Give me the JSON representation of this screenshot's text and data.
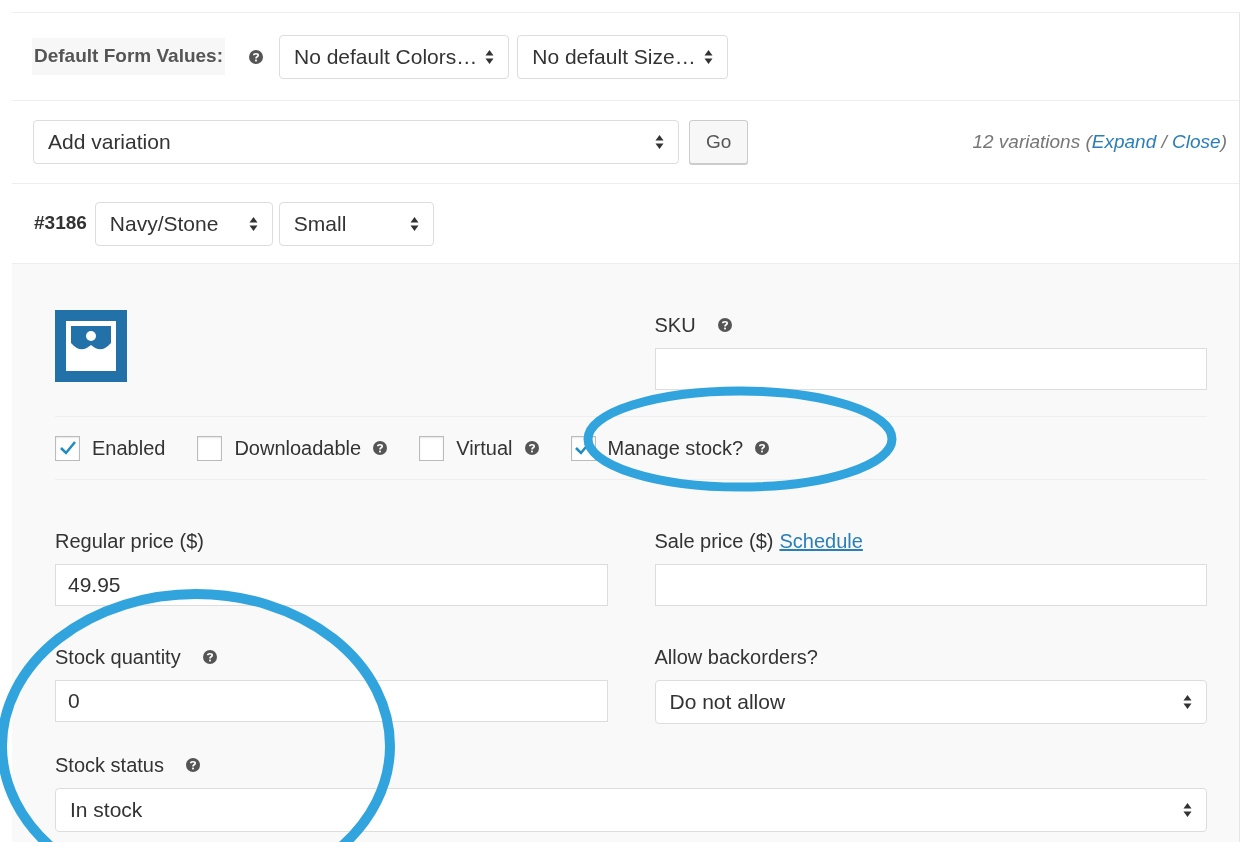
{
  "default_form_values": {
    "label": "Default Form Values:",
    "help": true,
    "selects": [
      {
        "value": "No default Colors…"
      },
      {
        "value": "No default Size…"
      }
    ]
  },
  "add_variation": {
    "select": "Add variation",
    "button": "Go",
    "summary": {
      "prefix": "12 variations (",
      "links": [
        {
          "label": "Expand"
        },
        {
          "label": "Close"
        }
      ],
      "separator": " / ",
      "suffix": ")"
    }
  },
  "variation": {
    "id": "#3186",
    "selects": [
      {
        "value": "Navy/Stone"
      },
      {
        "value": "Small"
      }
    ],
    "sku": {
      "label": "SKU",
      "help": true
    },
    "options": [
      {
        "label": "Enabled",
        "checked": true,
        "help": false
      },
      {
        "label": "Downloadable",
        "checked": false,
        "help": true
      },
      {
        "label": "Virtual",
        "checked": false,
        "help": true
      },
      {
        "label": "Manage stock?",
        "checked": true,
        "help": true
      }
    ],
    "regular_price": {
      "label": "Regular price ($)",
      "value": "49.95"
    },
    "sale_price": {
      "label": "Sale price ($)",
      "link": "Schedule"
    },
    "stock_quantity": {
      "label": "Stock quantity",
      "help": true,
      "value": "0"
    },
    "backorders": {
      "label": "Allow backorders?",
      "value": "Do not allow"
    },
    "stock_status": {
      "label": "Stock status",
      "help": true,
      "value": "In stock"
    }
  }
}
